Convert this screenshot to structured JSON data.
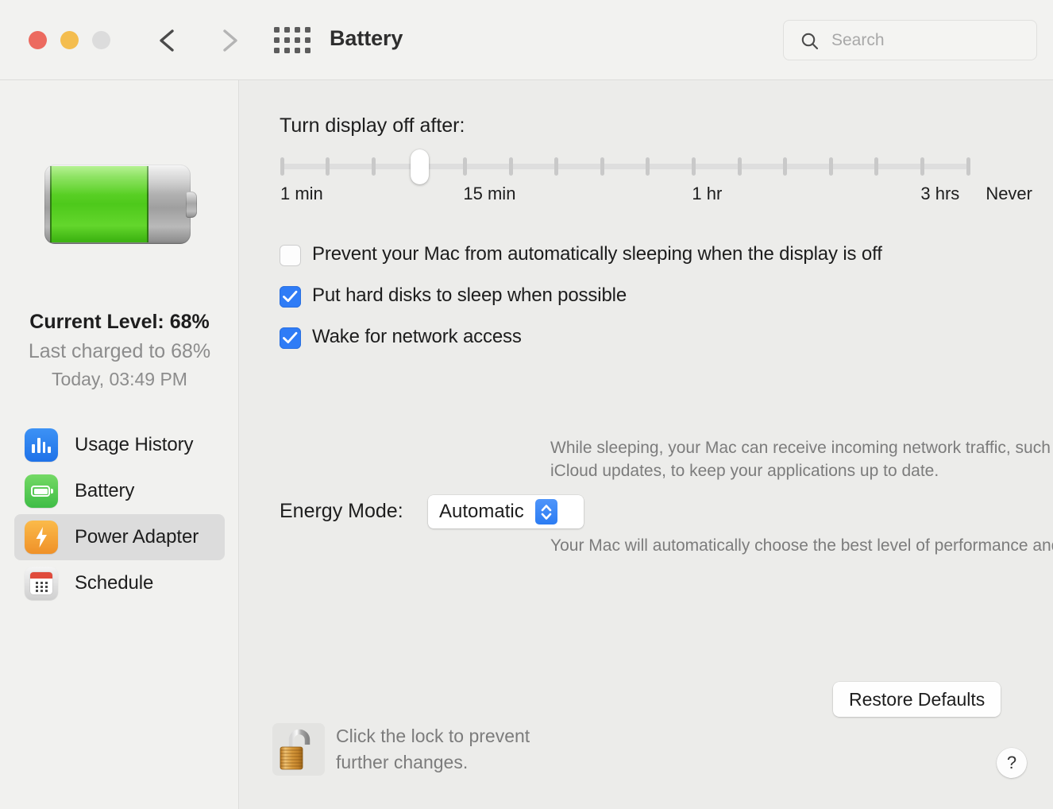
{
  "window": {
    "title": "Battery",
    "traffic_lights": [
      "close",
      "minimize",
      "maximize"
    ],
    "nav": {
      "back": "back-arrow",
      "forward": "forward-arrow"
    },
    "grid_button": "show-all-icon"
  },
  "search": {
    "placeholder": "Search",
    "value": "",
    "icon": "search-icon"
  },
  "sidebar": {
    "battery_icon": "battery-graphic",
    "current_level": "Current Level: 68%",
    "last_charged": "Last charged to 68%",
    "last_charged_time": "Today, 03:49 PM",
    "items": [
      {
        "label": "Usage History",
        "icon": "usage-history-icon",
        "selected": false
      },
      {
        "label": "Battery",
        "icon": "battery-icon",
        "selected": false
      },
      {
        "label": "Power Adapter",
        "icon": "power-adapter-icon",
        "selected": true
      },
      {
        "label": "Schedule",
        "icon": "schedule-icon",
        "selected": false
      }
    ]
  },
  "main": {
    "sleep_label": "Turn display off after:",
    "slider": {
      "tick_count": 16,
      "value_index": 3,
      "marks": [
        {
          "label": "1 min",
          "tick": 0
        },
        {
          "label": "15 min",
          "tick": 4
        },
        {
          "label": "1 hr",
          "tick": 9
        },
        {
          "label": "3 hrs",
          "tick": 14
        },
        {
          "label": "Never",
          "tick": 15
        }
      ]
    },
    "checkboxes": [
      {
        "label": "Prevent your Mac from automatically sleeping when the display is off",
        "checked": false
      },
      {
        "label": "Put hard disks to sleep when possible",
        "checked": true
      },
      {
        "label": "Wake for network access",
        "checked": true
      }
    ],
    "wake_description": "While sleeping, your Mac can receive incoming network traffic, such as iMessages and other iCloud updates, to keep your applications up to date.",
    "energy_mode_label": "Energy Mode:",
    "energy_mode_value": "Automatic",
    "energy_mode_options": [
      "Automatic"
    ],
    "energy_mode_description": "Your Mac will automatically choose the best level of performance and energy usage.",
    "restore_defaults": "Restore Defaults",
    "lock_icon": "unlocked-padlock-icon",
    "lock_text_line1": "Click the lock to prevent",
    "lock_text_line2": "further changes.",
    "help_label": "?"
  },
  "colors": {
    "accent_blue": "#2f7cf6",
    "battery_green": "#4ec91b",
    "power_orange": "#ef9128",
    "schedule_red": "#e04b3c",
    "window_bg": "#ececea",
    "sidebar_bg": "#f1f1ef",
    "titlebar_bg": "#f2f2f0"
  }
}
